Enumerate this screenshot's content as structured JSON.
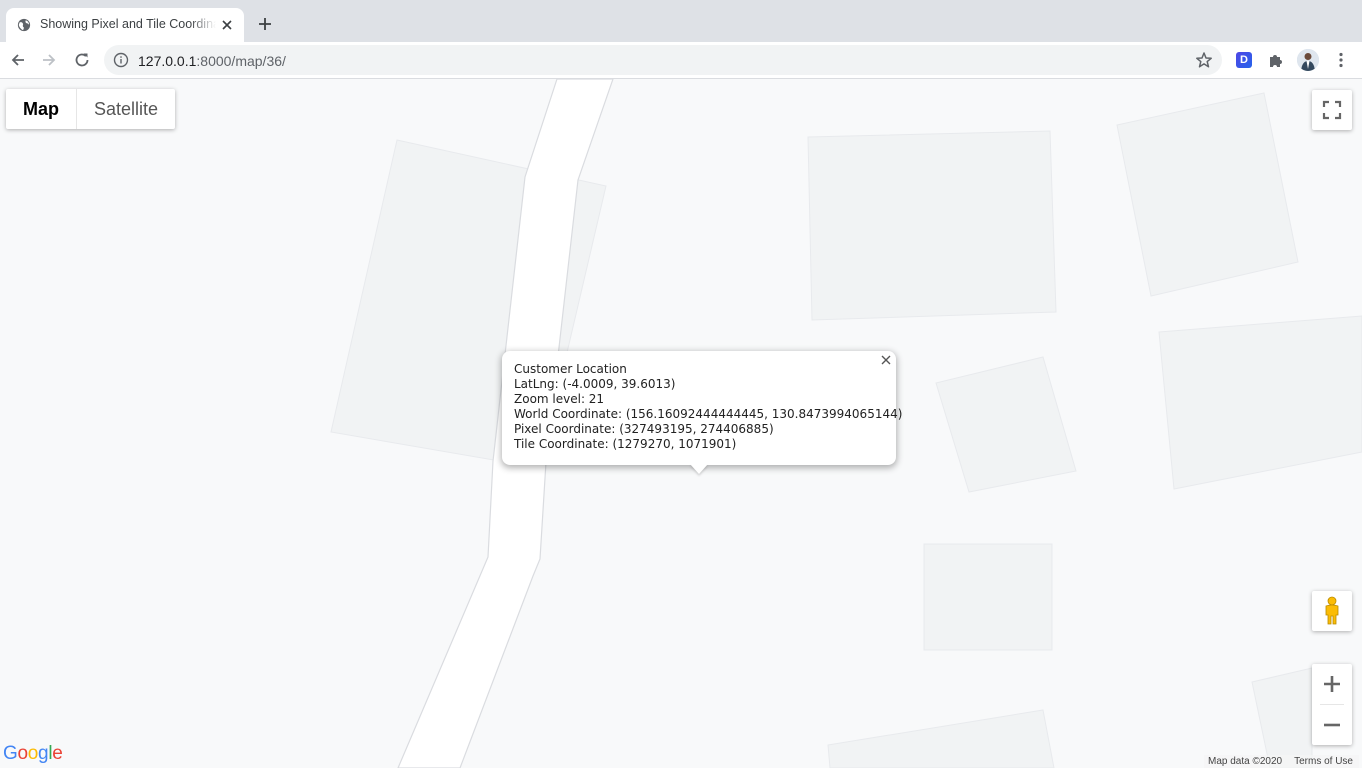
{
  "browser": {
    "tab": {
      "title": "Showing Pixel and Tile Coordinates",
      "favicon": "globe-icon",
      "close_icon": "close-icon"
    },
    "new_tab_icon": "plus-icon",
    "nav": {
      "back_icon": "arrow-left-icon",
      "forward_icon": "arrow-right-icon",
      "reload_icon": "reload-icon"
    },
    "address_bar": {
      "host": "127.0.0.1",
      "path": ":8000/map/36/",
      "info_icon": "info-icon",
      "bookmark_icon": "star-icon"
    },
    "extensions": {
      "d_label": "D",
      "puzzle_icon": "puzzle-icon"
    },
    "menu_icon": "kebab-icon"
  },
  "map": {
    "type_control": {
      "map_label": "Map",
      "satellite_label": "Satellite",
      "selected": "Map"
    },
    "fullscreen_icon": "fullscreen-icon",
    "pegman_icon": "pegman-icon",
    "zoom": {
      "in_icon": "plus-icon",
      "out_icon": "minus-icon"
    },
    "logo": {
      "letters": [
        "G",
        "o",
        "o",
        "g",
        "l",
        "e"
      ],
      "colors": [
        "#4285F4",
        "#EA4335",
        "#FBBC05",
        "#4285F4",
        "#34A853",
        "#EA4335"
      ]
    },
    "attribution": {
      "data": "Map data ©2020",
      "terms": "Terms of Use"
    },
    "colors": {
      "background": "#f8f9fa",
      "road": "#ffffff",
      "building": "#f1f3f4",
      "building_edge": "#e8eaed"
    }
  },
  "info_window": {
    "lines": [
      "Customer Location",
      "LatLng: (-4.0009, 39.6013)",
      "Zoom level: 21",
      "World Coordinate: (156.16092444444445, 130.8473994065144)",
      "Pixel Coordinate: (327493195, 274406885)",
      "Tile Coordinate: (1279270, 1071901)"
    ],
    "close_icon": "close-icon"
  }
}
